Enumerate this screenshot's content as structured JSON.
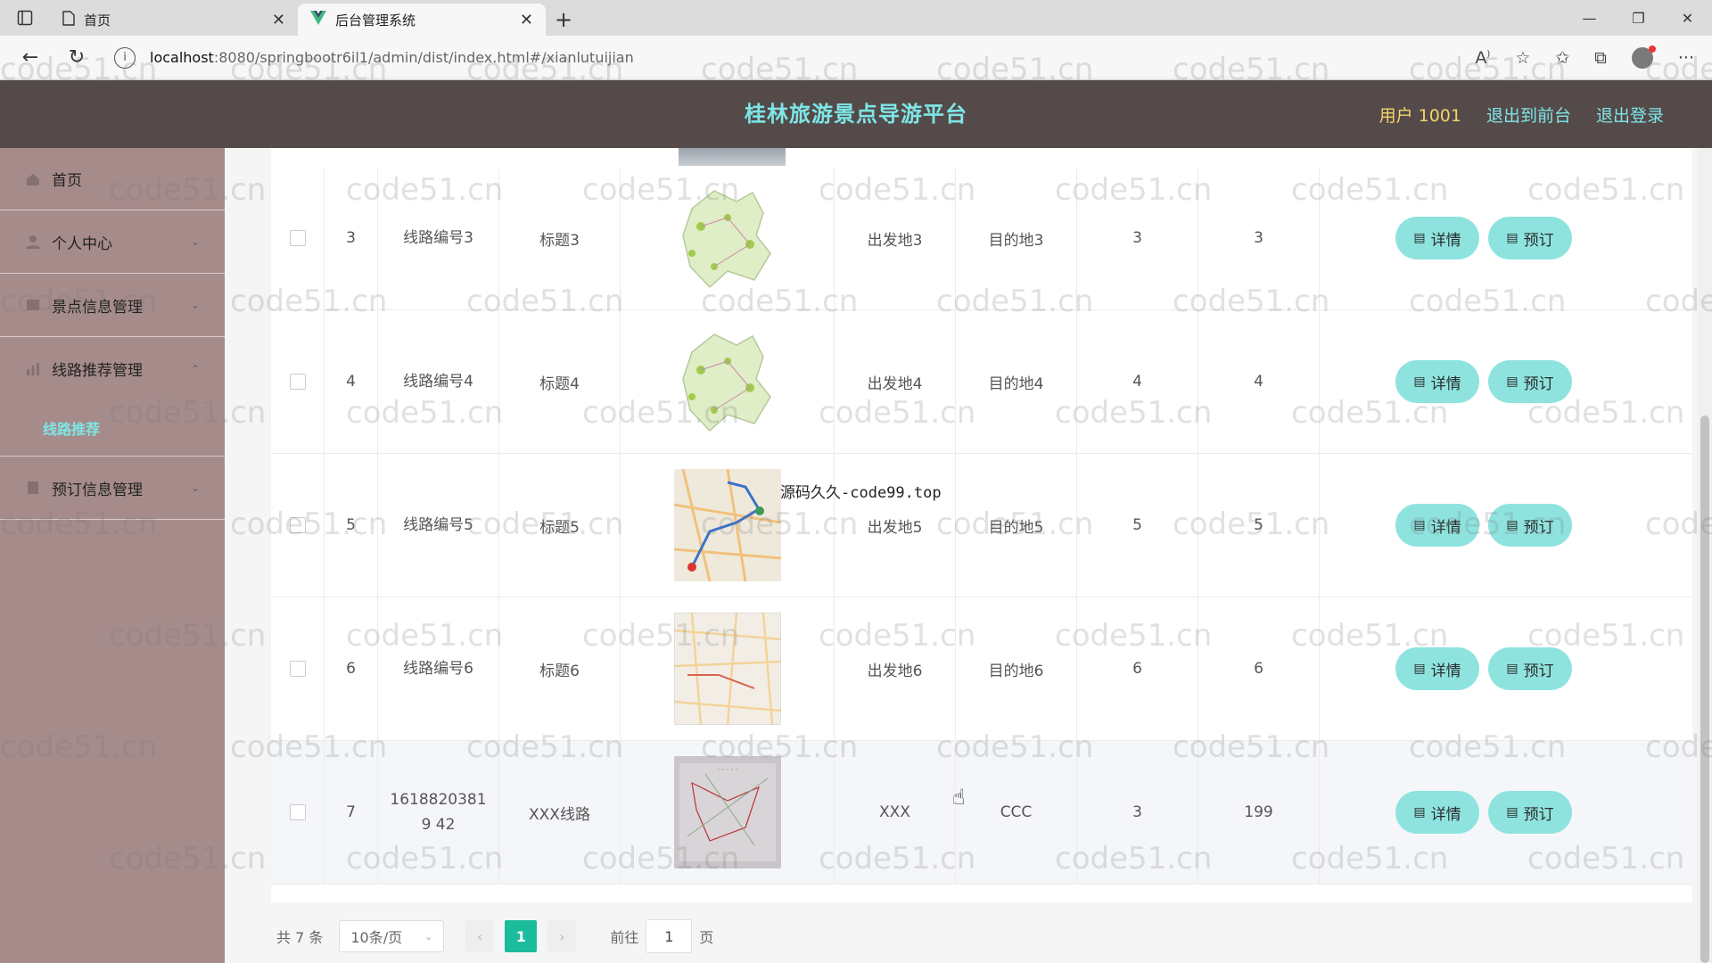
{
  "browser": {
    "tabs": [
      {
        "title": "首页",
        "active": false
      },
      {
        "title": "后台管理系统",
        "active": true
      }
    ],
    "url_host": "localhost",
    "url_path": ":8080/springbootr6il1/admin/dist/index.html#/xianlutuijian"
  },
  "header": {
    "title": "桂林旅游景点导游平台",
    "user": "用户 1001",
    "back_to_front": "退出到前台",
    "logout": "退出登录"
  },
  "sidebar": {
    "items": [
      {
        "label": "首页"
      },
      {
        "label": "个人中心"
      },
      {
        "label": "景点信息管理"
      },
      {
        "label": "线路推荐管理"
      }
    ],
    "active_sub": "线路推荐",
    "last_item": "预订信息管理"
  },
  "table": {
    "detail_label": "详情",
    "book_label": "预订",
    "rows": [
      {
        "idx": "3",
        "code": "线路编号3",
        "title": "标题3",
        "from": "出发地3",
        "to": "目的地3",
        "c1": "3",
        "c2": "3",
        "img": "map-green"
      },
      {
        "idx": "4",
        "code": "线路编号4",
        "title": "标题4",
        "from": "出发地4",
        "to": "目的地4",
        "c1": "4",
        "c2": "4",
        "img": "map-green"
      },
      {
        "idx": "5",
        "code": "线路编号5",
        "title": "标题5",
        "from": "出发地5",
        "to": "目的地5",
        "c1": "5",
        "c2": "5",
        "img": "road-map"
      },
      {
        "idx": "6",
        "code": "线路编号6",
        "title": "标题6",
        "from": "出发地6",
        "to": "目的地6",
        "c1": "6",
        "c2": "6",
        "img": "road-map-2"
      },
      {
        "idx": "7",
        "code": "16188203819 42",
        "title": "XXX线路",
        "from": "XXX",
        "to": "CCC",
        "c1": "3",
        "c2": "199",
        "img": "route-chart"
      }
    ]
  },
  "pagination": {
    "total": "共 7 条",
    "page_size": "10条/页",
    "current": "1",
    "goto_prefix": "前往",
    "goto_value": "1",
    "goto_suffix": "页"
  },
  "overlay_text": "源码久久-code99.top",
  "watermark": "code51.cn"
}
